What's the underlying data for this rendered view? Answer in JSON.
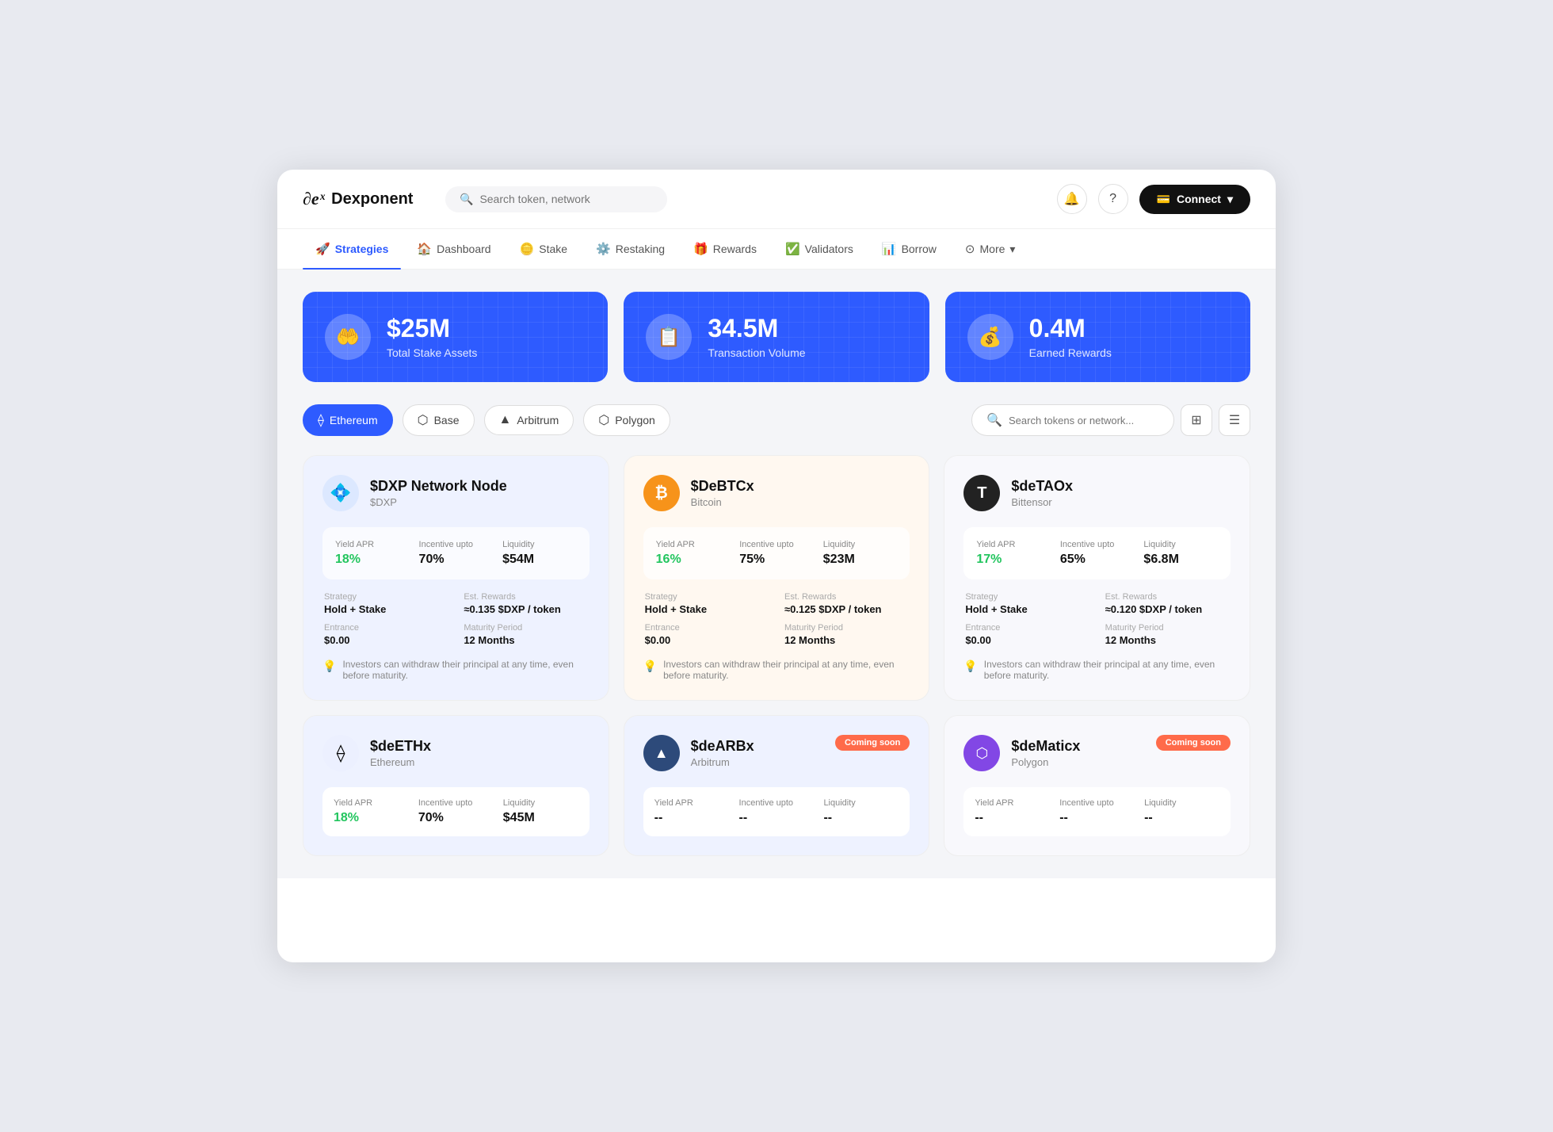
{
  "app": {
    "logo_symbol": "∂eˣ",
    "logo_name": "Dexponent"
  },
  "header": {
    "search_placeholder": "Search token, network",
    "connect_label": "Connect",
    "bell_icon": "🔔",
    "help_icon": "?"
  },
  "nav": {
    "items": [
      {
        "id": "strategies",
        "label": "Strategies",
        "icon": "🚀",
        "active": true
      },
      {
        "id": "dashboard",
        "label": "Dashboard",
        "icon": "🏠",
        "active": false
      },
      {
        "id": "stake",
        "label": "Stake",
        "icon": "🪙",
        "active": false
      },
      {
        "id": "restaking",
        "label": "Restaking",
        "icon": "⚙️",
        "active": false
      },
      {
        "id": "rewards",
        "label": "Rewards",
        "icon": "🎁",
        "active": false
      },
      {
        "id": "validators",
        "label": "Validators",
        "icon": "✅",
        "active": false
      },
      {
        "id": "borrow",
        "label": "Borrow",
        "icon": "📊",
        "active": false
      },
      {
        "id": "more",
        "label": "More",
        "icon": "⊙",
        "active": false
      }
    ]
  },
  "stats": [
    {
      "id": "total-stake",
      "value": "$25M",
      "label": "Total Stake Assets",
      "icon": "🤲"
    },
    {
      "id": "transaction-volume",
      "value": "34.5M",
      "label": "Transaction Volume",
      "icon": "📋"
    },
    {
      "id": "earned-rewards",
      "value": "0.4M",
      "label": "Earned Rewards",
      "icon": "💰"
    }
  ],
  "filters": {
    "networks": [
      {
        "id": "ethereum",
        "label": "Ethereum",
        "active": true,
        "icon": "⟠"
      },
      {
        "id": "base",
        "label": "Base",
        "active": false,
        "icon": "⬡"
      },
      {
        "id": "arbitrum",
        "label": "Arbitrum",
        "active": false,
        "icon": "▲"
      },
      {
        "id": "polygon",
        "label": "Polygon",
        "active": false,
        "icon": "⬡"
      }
    ],
    "search_placeholder": "Search tokens or network...",
    "grid_icon": "⊞",
    "list_icon": "☰"
  },
  "cards": [
    {
      "id": "dxp",
      "name": "$DXP Network Node",
      "token": "$DXP",
      "icon": "💠",
      "icon_bg": "#e0e8ff",
      "tint": "blue-tint",
      "coming_soon": false,
      "yield_apr": "18%",
      "yield_green": true,
      "incentive_upto": "70%",
      "liquidity": "$54M",
      "strategy": "Hold + Stake",
      "est_rewards": "≈0.135 $DXP / token",
      "entrance": "$0.00",
      "maturity_period": "12 Months",
      "note": "Investors can withdraw their principal at any time, even before maturity."
    },
    {
      "id": "debtcx",
      "name": "$DeBTCx",
      "token": "Bitcoin",
      "icon": "₿",
      "icon_bg": "#f7931a",
      "icon_color": "#fff",
      "tint": "orange-tint",
      "coming_soon": false,
      "yield_apr": "16%",
      "yield_green": true,
      "incentive_upto": "75%",
      "liquidity": "$23M",
      "strategy": "Hold + Stake",
      "est_rewards": "≈0.125 $DXP / token",
      "entrance": "$0.00",
      "maturity_period": "12 Months",
      "note": "Investors can withdraw their principal at any time, even before maturity."
    },
    {
      "id": "detaox",
      "name": "$deTAOx",
      "token": "Bittensor",
      "icon": "Τ",
      "icon_bg": "#222",
      "icon_color": "#fff",
      "tint": "gray-tint",
      "coming_soon": false,
      "yield_apr": "17%",
      "yield_green": true,
      "incentive_upto": "65%",
      "liquidity": "$6.8M",
      "strategy": "Hold + Stake",
      "est_rewards": "≈0.120 $DXP / token",
      "entrance": "$0.00",
      "maturity_period": "12 Months",
      "note": "Investors can withdraw their principal at any time, even before maturity."
    },
    {
      "id": "deethx",
      "name": "$deETHx",
      "token": "Ethereum",
      "icon": "⟠",
      "icon_bg": "#ecf0ff",
      "tint": "blue-tint",
      "coming_soon": false,
      "yield_apr": "18%",
      "yield_green": true,
      "incentive_upto": "70%",
      "liquidity": "$45M",
      "strategy": "",
      "est_rewards": "",
      "entrance": "",
      "maturity_period": "",
      "note": ""
    },
    {
      "id": "dearbx",
      "name": "$deARBx",
      "token": "Arbitrum",
      "icon": "▲",
      "icon_bg": "#2d4a7a",
      "icon_color": "#fff",
      "tint": "blue-tint",
      "coming_soon": true,
      "yield_apr": "--",
      "yield_green": false,
      "incentive_upto": "--",
      "liquidity": "--",
      "strategy": "",
      "est_rewards": "",
      "entrance": "",
      "maturity_period": "",
      "note": ""
    },
    {
      "id": "dematicx",
      "name": "$deMaticx",
      "token": "Polygon",
      "icon": "⬡",
      "icon_bg": "#8247e5",
      "icon_color": "#fff",
      "tint": "gray-tint",
      "coming_soon": true,
      "yield_apr": "--",
      "yield_green": false,
      "incentive_upto": "--",
      "liquidity": "--",
      "strategy": "",
      "est_rewards": "",
      "entrance": "",
      "maturity_period": "",
      "note": ""
    }
  ],
  "labels": {
    "yield_apr": "Yield APR",
    "incentive_upto": "Incentive upto",
    "liquidity": "Liquidity",
    "strategy": "Strategy",
    "est_rewards": "Est. Rewards",
    "entrance": "Entrance",
    "maturity_period": "Maturity Period",
    "coming_soon": "Coming soon"
  }
}
